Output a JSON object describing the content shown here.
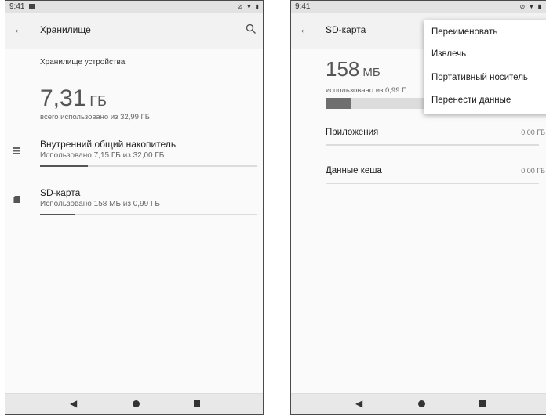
{
  "left_screen": {
    "status": {
      "time": "9:41"
    },
    "app_bar": {
      "title": "Хранилище"
    },
    "section_title": "Хранилище устройства",
    "total": {
      "value": "7,31",
      "unit": "ГБ",
      "subtitle": "всего использовано из 32,99 ГБ"
    },
    "items": [
      {
        "title": "Внутренний общий накопитель",
        "subtitle": "Использовано 7,15 ГБ из 32,00 ГБ",
        "progress": 0.22
      },
      {
        "title": "SD-карта",
        "subtitle": "Использовано 158 МБ из 0,99 ГБ",
        "progress": 0.16
      }
    ]
  },
  "right_screen": {
    "status": {
      "time": "9:41"
    },
    "app_bar": {
      "title": "SD-карта"
    },
    "used": {
      "value": "158",
      "unit": "МБ",
      "subtitle": "использовано из 0,99 Г",
      "progress": 0.16
    },
    "categories": [
      {
        "label": "Приложения",
        "value": "0,00 ГБ"
      },
      {
        "label": "Данные кеша",
        "value": "0,00 ГБ"
      }
    ],
    "menu": {
      "items": [
        "Переименовать",
        "Извлечь",
        "Портативный носитель",
        "Перенести данные"
      ]
    }
  },
  "icons": {
    "back": "back-arrow-icon",
    "search": "search-icon",
    "internal_storage": "storage-list-icon",
    "sd_card": "sd-card-icon",
    "nav_back": "triangle-back-icon",
    "nav_home": "circle-home-icon",
    "nav_recent": "square-recents-icon"
  }
}
